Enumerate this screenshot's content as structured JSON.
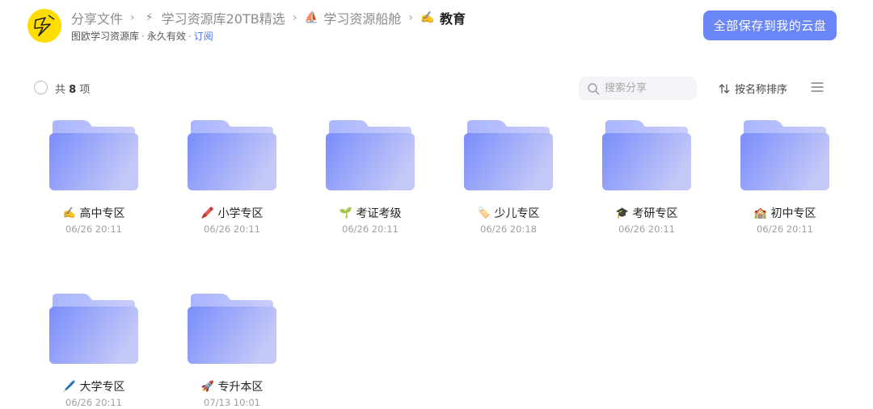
{
  "header": {
    "breadcrumbs": [
      {
        "emoji": "",
        "label": "分享文件"
      },
      {
        "emoji": "⚡",
        "label": "学习资源库20TB精选"
      },
      {
        "emoji": "⛵",
        "label": "学习资源船舱"
      },
      {
        "emoji": "✍️",
        "label": "教育"
      }
    ],
    "separator": "›",
    "owner": "图欧学习资源库",
    "validity": "永久有效",
    "dot": "·",
    "subscribe": "订阅",
    "save_all": "全部保存到我的云盘"
  },
  "toolbar": {
    "count_prefix": "共",
    "count": "8",
    "count_suffix": "项",
    "search_placeholder": "搜索分享",
    "sort_label": "按名称排序"
  },
  "colors": {
    "accent": "#6a86f8",
    "link": "#4c74f5",
    "avatar_bg": "#ffdd00",
    "folder_light": "#a9b6ff",
    "folder_dark": "#7a8dfb"
  },
  "folders": [
    {
      "emoji": "✍️",
      "name": "高中专区",
      "date": "06/26 20:11"
    },
    {
      "emoji": "🖍️",
      "name": "小学专区",
      "date": "06/26 20:11"
    },
    {
      "emoji": "🌱",
      "name": "考证考级",
      "date": "06/26 20:11"
    },
    {
      "emoji": "🏷️",
      "name": "少儿专区",
      "date": "06/26 20:18"
    },
    {
      "emoji": "🎓",
      "name": "考研专区",
      "date": "06/26 20:11"
    },
    {
      "emoji": "🏫",
      "name": "初中专区",
      "date": "06/26 20:11"
    },
    {
      "emoji": "🖊️",
      "name": "大学专区",
      "date": "06/26 20:11"
    },
    {
      "emoji": "🚀",
      "name": "专升本区",
      "date": "07/13 10:01"
    }
  ]
}
